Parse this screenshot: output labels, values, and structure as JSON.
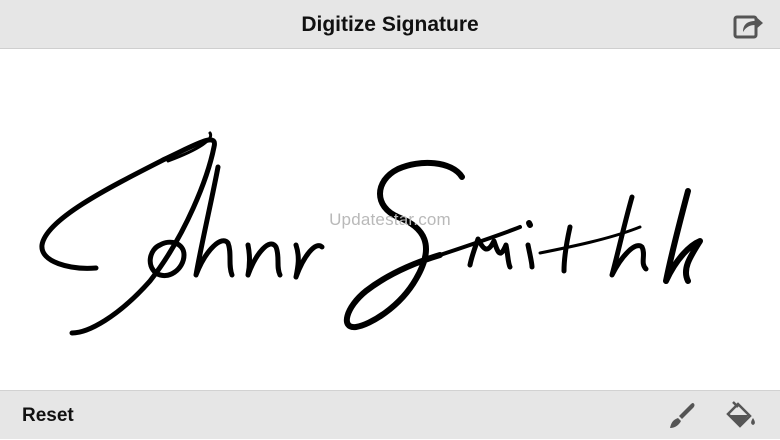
{
  "header": {
    "title": "Digitize Signature"
  },
  "canvas": {
    "watermark": "Updatestar.com",
    "signature_text": "John Smith",
    "ink_color": "#000000"
  },
  "toolbar": {
    "reset_label": "Reset"
  },
  "icons": {
    "share": "share-icon",
    "brush": "brush-icon",
    "fill": "paint-bucket-icon"
  },
  "colors": {
    "bar_background": "#e6e6e6",
    "icon_color": "#555555"
  }
}
